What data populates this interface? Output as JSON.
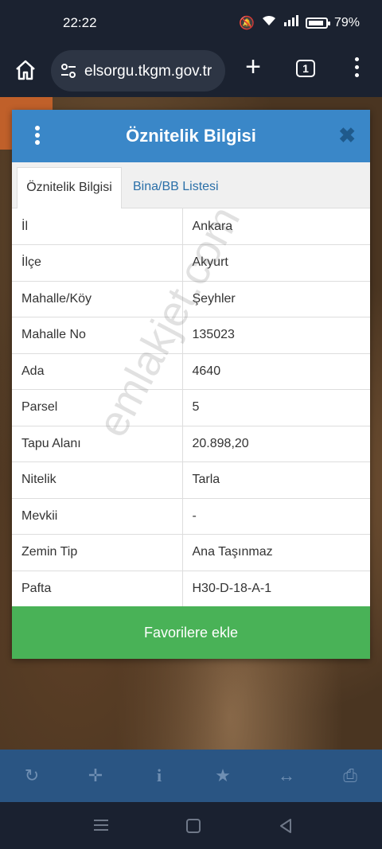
{
  "status": {
    "time": "22:22",
    "battery": "79%"
  },
  "browser": {
    "url": "elsorgu.tkgm.gov.tr",
    "tab_count": "1"
  },
  "dialog": {
    "title": "Öznitelik Bilgisi",
    "tabs": [
      {
        "label": "Öznitelik Bilgisi",
        "active": true
      },
      {
        "label": "Bina/BB Listesi",
        "active": false
      }
    ],
    "rows": [
      {
        "key": "İl",
        "value": "Ankara"
      },
      {
        "key": "İlçe",
        "value": "Akyurt"
      },
      {
        "key": "Mahalle/Köy",
        "value": "Şeyhler"
      },
      {
        "key": "Mahalle No",
        "value": "135023"
      },
      {
        "key": "Ada",
        "value": "4640"
      },
      {
        "key": "Parsel",
        "value": "5"
      },
      {
        "key": "Tapu Alanı",
        "value": "20.898,20"
      },
      {
        "key": "Nitelik",
        "value": "Tarla"
      },
      {
        "key": "Mevkii",
        "value": "-"
      },
      {
        "key": "Zemin Tip",
        "value": "Ana Taşınmaz"
      },
      {
        "key": "Pafta",
        "value": "H30-D-18-A-1"
      }
    ],
    "favorite_label": "Favorilere ekle"
  },
  "watermark": "emlakjet.com",
  "toolbar": [
    "refresh-icon",
    "crosshair-icon",
    "info-icon",
    "star-icon",
    "measure-icon",
    "print-icon"
  ],
  "colors": {
    "header": "#3a87c8",
    "favorite": "#49b257",
    "toolbar": "#2a5583"
  }
}
